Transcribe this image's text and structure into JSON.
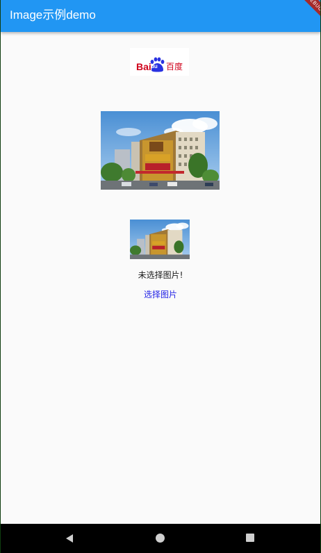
{
  "appbar": {
    "title": "Image示例demo",
    "debug_banner": "DEBUG"
  },
  "logo": {
    "text_latin": "Bai",
    "text_du": "du",
    "text_cn": "百度"
  },
  "main": {
    "status_text": "未选择图片!",
    "select_button_label": "选择图片"
  },
  "colors": {
    "appbar": "#2196f3",
    "link": "#2424e6",
    "background": "#fafafa"
  },
  "navbar": {
    "back_icon": "back-triangle-icon",
    "home_icon": "home-circle-icon",
    "recent_icon": "recent-square-icon"
  }
}
